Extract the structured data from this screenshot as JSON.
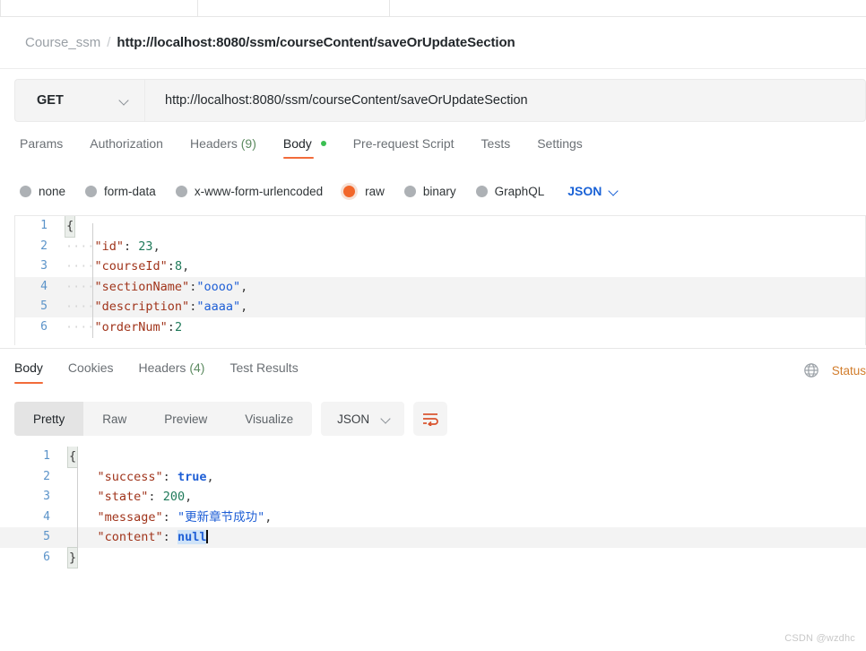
{
  "app": "Postman",
  "breadcrumb": {
    "collection": "Course_ssm",
    "separator": "/",
    "request_name": "http://localhost:8080/ssm/courseContent/saveOrUpdateSection"
  },
  "url_bar": {
    "method": "GET",
    "url": "http://localhost:8080/ssm/courseContent/saveOrUpdateSection"
  },
  "request_tabs": [
    {
      "label": "Params",
      "active": false
    },
    {
      "label": "Authorization",
      "active": false
    },
    {
      "label": "Headers",
      "count": "(9)",
      "active": false
    },
    {
      "label": "Body",
      "active": true,
      "dot": true
    },
    {
      "label": "Pre-request Script",
      "active": false
    },
    {
      "label": "Tests",
      "active": false
    },
    {
      "label": "Settings",
      "active": false
    }
  ],
  "body_types": {
    "options": [
      {
        "label": "none",
        "selected": false
      },
      {
        "label": "form-data",
        "selected": false
      },
      {
        "label": "x-www-form-urlencoded",
        "selected": false
      },
      {
        "label": "raw",
        "selected": true
      },
      {
        "label": "binary",
        "selected": false
      },
      {
        "label": "GraphQL",
        "selected": false
      }
    ],
    "format": "JSON"
  },
  "request_body": {
    "language": "JSON",
    "lines": [
      {
        "n": "1",
        "parts": [
          {
            "t": "{",
            "c": "brace"
          }
        ]
      },
      {
        "n": "2",
        "parts": [
          {
            "t": "····",
            "c": "ind"
          },
          {
            "t": "\"id\"",
            "c": "key"
          },
          {
            "t": ": ",
            "c": "punc"
          },
          {
            "t": "23",
            "c": "num"
          },
          {
            "t": ",",
            "c": "punc"
          }
        ]
      },
      {
        "n": "3",
        "parts": [
          {
            "t": "····",
            "c": "ind"
          },
          {
            "t": "\"courseId\"",
            "c": "key"
          },
          {
            "t": ":",
            "c": "punc"
          },
          {
            "t": "8",
            "c": "num"
          },
          {
            "t": ",",
            "c": "punc"
          }
        ]
      },
      {
        "n": "4",
        "hl": true,
        "parts": [
          {
            "t": "····",
            "c": "ind"
          },
          {
            "t": "\"sectionName\"",
            "c": "key"
          },
          {
            "t": ":",
            "c": "punc"
          },
          {
            "t": "\"oooo\"",
            "c": "str"
          },
          {
            "t": ",",
            "c": "punc"
          }
        ]
      },
      {
        "n": "5",
        "hl": true,
        "parts": [
          {
            "t": "····",
            "c": "ind"
          },
          {
            "t": "\"description\"",
            "c": "key"
          },
          {
            "t": ":",
            "c": "punc"
          },
          {
            "t": "\"aaaa\"",
            "c": "str"
          },
          {
            "t": ",",
            "c": "punc"
          }
        ]
      },
      {
        "n": "6",
        "parts": [
          {
            "t": "····",
            "c": "ind"
          },
          {
            "t": "\"orderNum\"",
            "c": "key"
          },
          {
            "t": ":",
            "c": "punc"
          },
          {
            "t": "2",
            "c": "num"
          }
        ]
      }
    ]
  },
  "response_tabs": [
    {
      "label": "Body",
      "active": true
    },
    {
      "label": "Cookies",
      "active": false
    },
    {
      "label": "Headers",
      "count": "(4)",
      "active": false
    },
    {
      "label": "Test Results",
      "active": false
    }
  ],
  "response_status": {
    "icon": "globe-icon",
    "text": "Status"
  },
  "view_toolbar": {
    "views": [
      {
        "label": "Pretty",
        "active": true
      },
      {
        "label": "Raw",
        "active": false
      },
      {
        "label": "Preview",
        "active": false
      },
      {
        "label": "Visualize",
        "active": false
      }
    ],
    "format": "JSON",
    "wrap_icon": "word-wrap-icon"
  },
  "response_body": {
    "language": "JSON",
    "lines": [
      {
        "n": "1",
        "parts": [
          {
            "t": "{",
            "c": "brace"
          }
        ]
      },
      {
        "n": "2",
        "parts": [
          {
            "t": "    ",
            "c": "punc"
          },
          {
            "t": "\"success\"",
            "c": "key"
          },
          {
            "t": ": ",
            "c": "punc"
          },
          {
            "t": "true",
            "c": "bool"
          },
          {
            "t": ",",
            "c": "punc"
          }
        ]
      },
      {
        "n": "3",
        "parts": [
          {
            "t": "    ",
            "c": "punc"
          },
          {
            "t": "\"state\"",
            "c": "key"
          },
          {
            "t": ": ",
            "c": "punc"
          },
          {
            "t": "200",
            "c": "num"
          },
          {
            "t": ",",
            "c": "punc"
          }
        ]
      },
      {
        "n": "4",
        "parts": [
          {
            "t": "    ",
            "c": "punc"
          },
          {
            "t": "\"message\"",
            "c": "key"
          },
          {
            "t": ": ",
            "c": "punc"
          },
          {
            "t": "\"更新章节成功\"",
            "c": "str"
          },
          {
            "t": ",",
            "c": "punc"
          }
        ]
      },
      {
        "n": "5",
        "hl": true,
        "caret": true,
        "parts": [
          {
            "t": "    ",
            "c": "punc"
          },
          {
            "t": "\"content\"",
            "c": "key"
          },
          {
            "t": ": ",
            "c": "punc"
          },
          {
            "t": "null",
            "c": "null"
          }
        ]
      },
      {
        "n": "6",
        "parts": [
          {
            "t": "}",
            "c": "brace"
          }
        ]
      }
    ]
  },
  "watermark": "CSDN @wzdhc",
  "colors": {
    "accent_orange": "#f26b3a",
    "link_blue": "#1a62d6",
    "json_key": "#a0341b",
    "json_string": "#1f5fd6",
    "json_number": "#1f7a5a",
    "status_orange": "#d27d2c",
    "dot_green": "#3bbf52"
  }
}
